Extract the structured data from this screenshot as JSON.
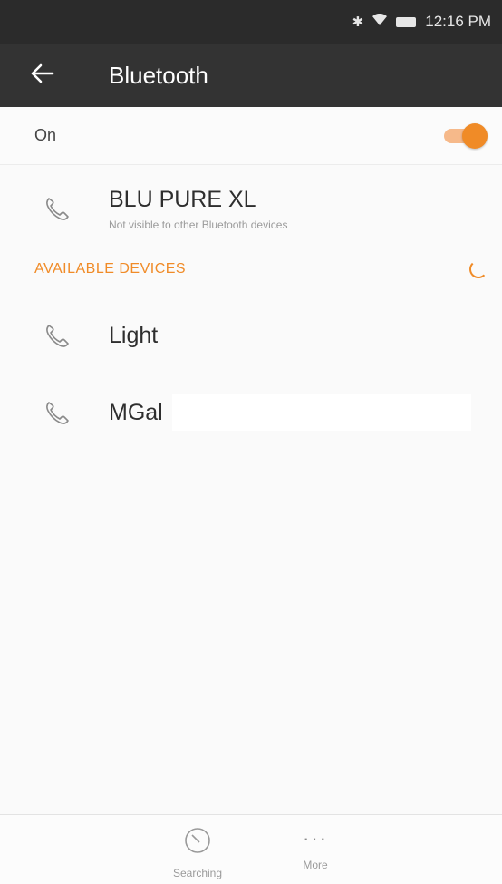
{
  "status_bar": {
    "time": "12:16 PM",
    "icons": [
      "bluetooth-icon",
      "wifi-icon",
      "battery-icon"
    ]
  },
  "app_bar": {
    "title": "Bluetooth",
    "back_icon": "back-arrow-icon"
  },
  "toggle": {
    "label": "On",
    "state": true,
    "accent_color": "#f08b27"
  },
  "paired_device": {
    "name": "BLU PURE XL",
    "subtitle": "Not visible to other Bluetooth devices",
    "icon": "phone-icon"
  },
  "available_section": {
    "title": "AVAILABLE DEVICES",
    "loading": true
  },
  "available_devices": [
    {
      "name": "Light",
      "icon": "phone-icon"
    },
    {
      "name": "MGal",
      "icon": "phone-icon"
    }
  ],
  "bottom_bar": {
    "refresh_label": "Searching",
    "more_label": "More"
  },
  "colors": {
    "header_bg": "#333333",
    "accent": "#f08b27",
    "background": "#fafafa"
  }
}
